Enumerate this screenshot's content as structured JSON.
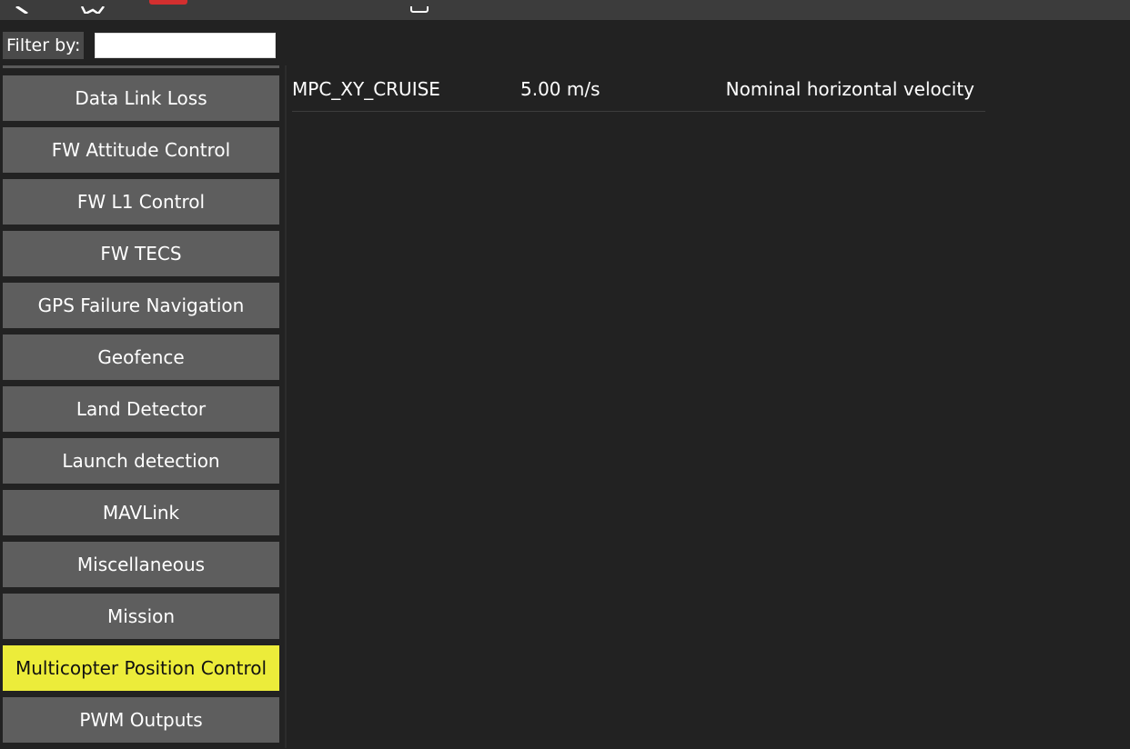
{
  "toolbar": {
    "icons": [
      "back-icon",
      "plan-icon",
      "alert-indicator",
      "battery-icon"
    ],
    "alert_color": "#d32f2f"
  },
  "filter": {
    "label": "Filter by:",
    "value": ""
  },
  "sidebar": {
    "active_color": "#ecec3a",
    "items": [
      {
        "label": "Data Link Loss"
      },
      {
        "label": "FW Attitude Control"
      },
      {
        "label": "FW L1 Control"
      },
      {
        "label": "FW TECS"
      },
      {
        "label": "GPS Failure Navigation"
      },
      {
        "label": "Geofence"
      },
      {
        "label": "Land Detector"
      },
      {
        "label": "Launch detection"
      },
      {
        "label": "MAVLink"
      },
      {
        "label": "Miscellaneous"
      },
      {
        "label": "Mission"
      },
      {
        "label": "Multicopter Position Control",
        "selected": true
      },
      {
        "label": "PWM Outputs"
      }
    ]
  },
  "params": [
    {
      "name": "MPC_XY_CRUISE",
      "value": "5.00 m/s",
      "description": "Nominal horizontal velocity"
    }
  ]
}
